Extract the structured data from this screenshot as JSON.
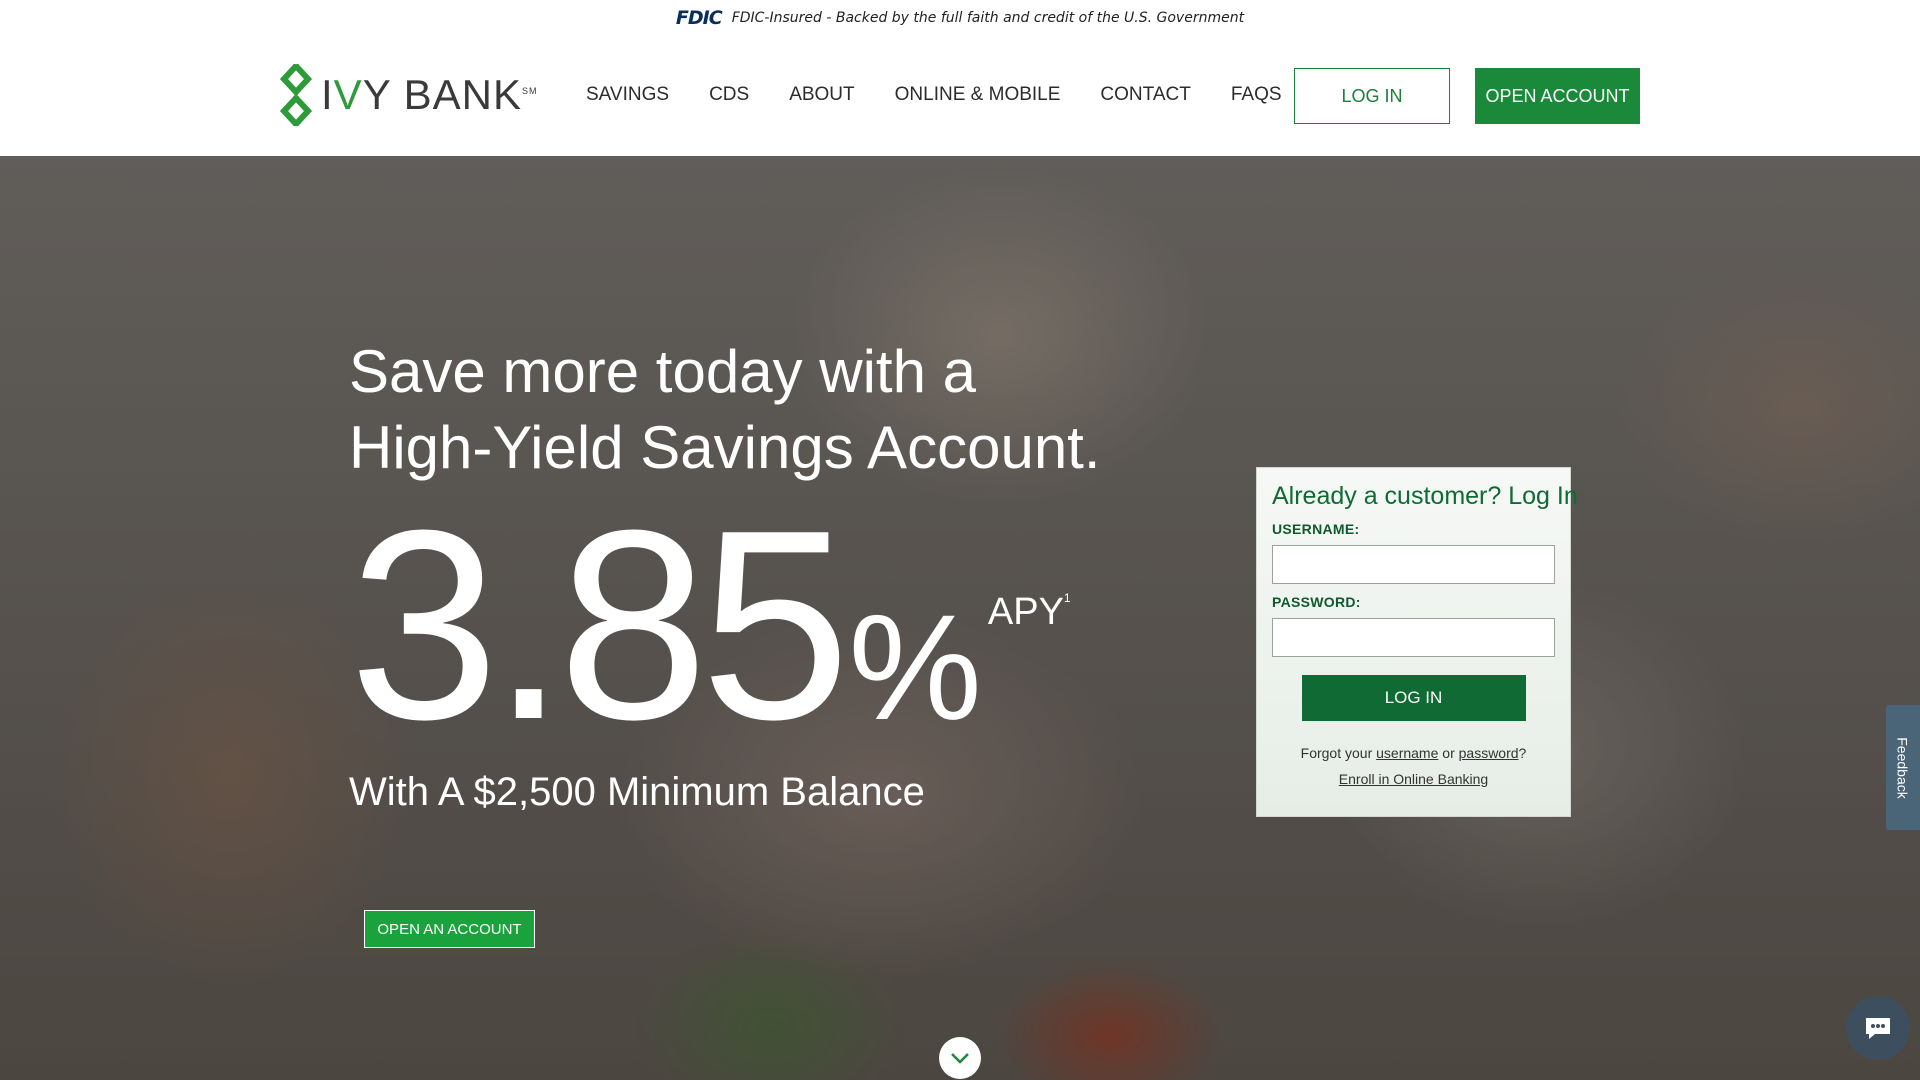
{
  "fdic": {
    "logo": "FDIC",
    "text": "FDIC-Insured - Backed by the full faith and credit of the U.S. Government"
  },
  "header": {
    "logo_prefix": "I",
    "logo_v": "V",
    "logo_rest": "Y BANK",
    "logo_sm": "SM",
    "nav": [
      "SAVINGS",
      "CDS",
      "ABOUT",
      "ONLINE & MOBILE",
      "CONTACT",
      "FAQS"
    ],
    "login_label": "LOG IN",
    "open_label": "OPEN ACCOUNT"
  },
  "hero": {
    "title_line1": "Save more today with a",
    "title_line2": "High-Yield Savings Account.",
    "rate": "3.85",
    "percent": "%",
    "apy": "APY",
    "apy_footnote": "1",
    "subtitle": "With A $2,500 Minimum Balance",
    "cta_label": "OPEN AN ACCOUNT"
  },
  "login_panel": {
    "title": "Already a customer? Log In",
    "username_label": "USERNAME:",
    "password_label": "PASSWORD:",
    "button_label": "LOG IN",
    "forgot_prefix": "Forgot your",
    "forgot_username": "username",
    "forgot_or": "or",
    "forgot_password": "password",
    "forgot_suffix": "?",
    "enroll_label": "Enroll in Online Banking"
  },
  "feedback_label": "Feedback",
  "colors": {
    "brand_green": "#1a8a3a",
    "dark_green": "#0f6b33",
    "navy": "#0b2d5b"
  },
  "icons": {
    "chat": "chat-bubble-icon",
    "scroll": "chevron-down-icon",
    "logo": "ivy-leaf-logo-icon"
  }
}
